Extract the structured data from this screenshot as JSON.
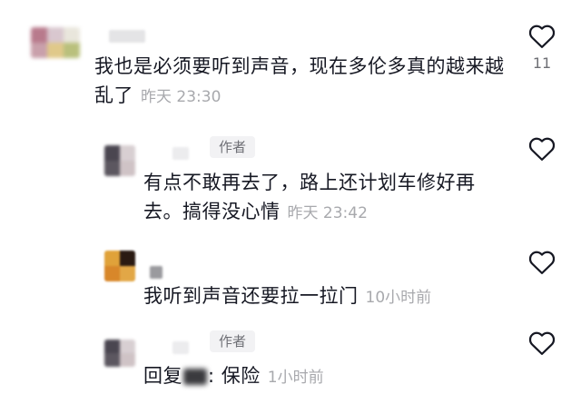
{
  "comments": [
    {
      "text": "我也是必须要听到声音，现在多伦多真的越来越乱了",
      "time": "昨天 23:30",
      "likes": "11",
      "is_author": false
    },
    {
      "text": "有点不敢再去了，路上还计划车修好再去。搞得没心情",
      "time": "昨天 23:42",
      "badge": "作者",
      "likes": "",
      "is_author": true
    },
    {
      "text": "我听到声音还要拉一拉门",
      "time": "10小时前",
      "likes": "",
      "is_author": false
    },
    {
      "reply_prefix": "回复",
      "text_after_mention": ": 保险",
      "time": "1小时前",
      "badge": "作者",
      "likes": "",
      "is_author": true
    }
  ],
  "icons": {
    "like": "heart-outline-icon"
  },
  "colors": {
    "text": "#161823",
    "meta": "#a8a9ad",
    "badge_bg": "#f2f2f4"
  }
}
